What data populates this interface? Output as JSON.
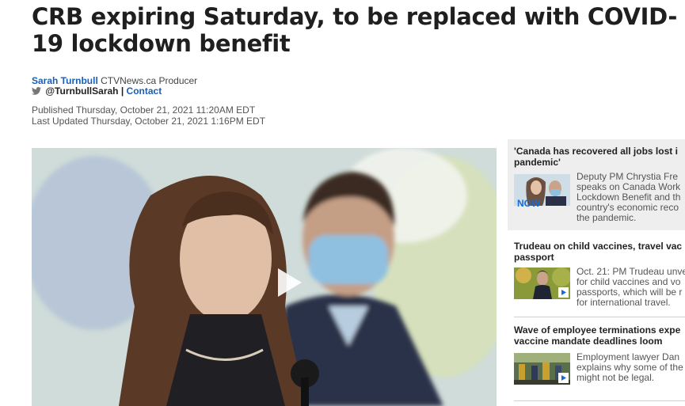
{
  "article": {
    "headline": "CRB expiring Saturday, to be replaced with COVID-19 lockdown benefit",
    "author": "Sarah Turnbull",
    "author_role": "CTVNews.ca Producer",
    "twitter_handle": "@TurnbullSarah",
    "separator": "|",
    "contact_label": "Contact",
    "published": "Published Thursday, October 21, 2021 11:20AM EDT",
    "updated": "Last Updated Thursday, October 21, 2021 1:16PM EDT"
  },
  "video": {
    "icon": "play-icon"
  },
  "sidebar": {
    "stories": [
      {
        "title_line1": "'Canada has recovered all jobs lost i",
        "title_line2": "pandemic'",
        "badge": "NOW",
        "desc": [
          "Deputy PM Chrystia Fre",
          "speaks on Canada Work",
          "Lockdown Benefit and th",
          "country's economic reco",
          "the pandemic."
        ]
      },
      {
        "title_line1": "Trudeau on child vaccines, travel vac",
        "title_line2": "passport",
        "desc": [
          "Oct. 21: PM Trudeau unve",
          "for child vaccines and vo",
          "passports, which will be r",
          "for international travel."
        ]
      },
      {
        "title_line1": "Wave of employee terminations expe",
        "title_line2": "vaccine mandate deadlines loom",
        "desc": [
          "Employment lawyer Dan",
          "explains why some of the",
          "might not be legal."
        ]
      }
    ]
  },
  "colors": {
    "link_blue": "#1a5fb4",
    "now_blue": "#1a6ad6",
    "featured_bg": "#eeeeee"
  }
}
